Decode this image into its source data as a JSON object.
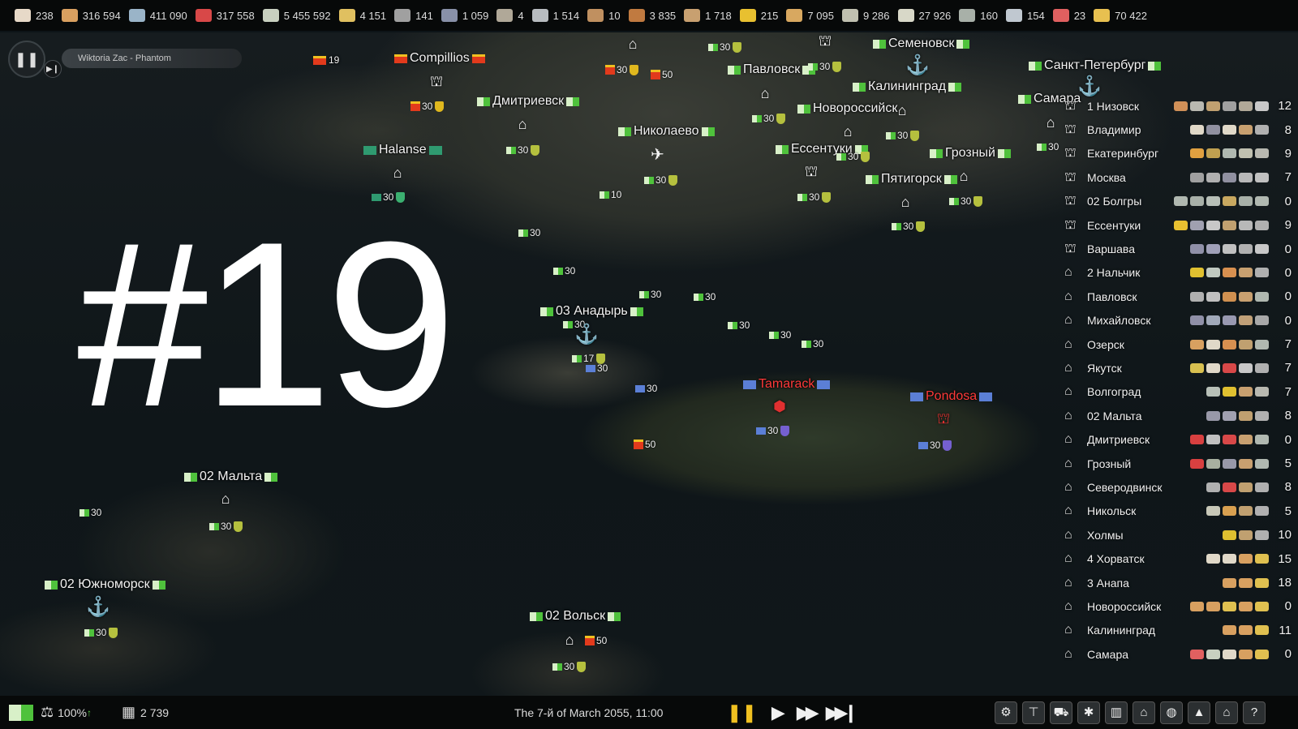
{
  "resources": [
    {
      "value": "238",
      "icon": "paper-icon",
      "color": "#e7d9c8"
    },
    {
      "value": "316 594",
      "icon": "bread-icon",
      "color": "#d9a060"
    },
    {
      "value": "411 090",
      "icon": "feather-icon",
      "color": "#9ab4c8"
    },
    {
      "value": "317 558",
      "icon": "meat-can-icon",
      "color": "#d84848"
    },
    {
      "value": "5 455 592",
      "icon": "bandage-icon",
      "color": "#c8d0c0"
    },
    {
      "value": "4 151",
      "icon": "bullets-icon",
      "color": "#e0c060"
    },
    {
      "value": "141",
      "icon": "ore-icon",
      "color": "#a0a0a0"
    },
    {
      "value": "1 059",
      "icon": "steel-bar-icon",
      "color": "#8890a8"
    },
    {
      "value": "4",
      "icon": "ore-pile-icon",
      "color": "#b0a898"
    },
    {
      "value": "1 514",
      "icon": "metal-bar-icon",
      "color": "#b8bcc0"
    },
    {
      "value": "10",
      "icon": "nuts-icon",
      "color": "#c09060"
    },
    {
      "value": "3 835",
      "icon": "wood-log-icon",
      "color": "#c07a40"
    },
    {
      "value": "1 718",
      "icon": "grain-pile-icon",
      "color": "#c8a070"
    },
    {
      "value": "215",
      "icon": "gold-bar-icon",
      "color": "#e8c030"
    },
    {
      "value": "7 095",
      "icon": "baguette-icon",
      "color": "#d8a860"
    },
    {
      "value": "9 286",
      "icon": "crate-icon",
      "color": "#c0c0b0"
    },
    {
      "value": "27 926",
      "icon": "cotton-icon",
      "color": "#d8d8c8"
    },
    {
      "value": "160",
      "icon": "board-icon",
      "color": "#a8b0a8"
    },
    {
      "value": "154",
      "icon": "bottle-icon",
      "color": "#c0c8d0"
    },
    {
      "value": "23",
      "icon": "ham-icon",
      "color": "#e06060"
    },
    {
      "value": "70 422",
      "icon": "corn-icon",
      "color": "#e8c050"
    }
  ],
  "player": {
    "pause_glyph": "❚❚",
    "skip_glyph": "▶❙",
    "track": "Wiktoria Zac - Phantom"
  },
  "overlay_number": "#19",
  "map_labels": {
    "compillios": "Compillios",
    "dmitrievsk": "Дмитриевск",
    "halanse": "Halanse",
    "pavlovsk": "Павловск",
    "semenovsk": "Семеновск",
    "spb": "Санкт-Петербург",
    "kaliningrad": "Калининград",
    "novorossiysk": "Новороссийск",
    "samara": "Самара",
    "nikolaevo": "Николаево",
    "yessentuki": "Ессентуки",
    "grozny": "Грозный",
    "pyatigorsk": "Пятигорск",
    "anadyr": "03 Анадырь",
    "tamarack": "Tamarack",
    "pondosa": "Pondosa",
    "malta": "02 Мальта",
    "yuzhnomorsk": "02 Южноморск",
    "volsk": "02 Вольск"
  },
  "map_numbers": {
    "n19": "19",
    "n30": "30",
    "n50": "50",
    "n10": "10",
    "n17": "17"
  },
  "settlements": [
    {
      "icon": "factory-icon",
      "name": "1 Низовск",
      "items": [
        "#d09058",
        "#b8b8b0",
        "#c0a070",
        "#a0a0a0",
        "#b0a898",
        "#c8c8c8"
      ],
      "count": "12"
    },
    {
      "icon": "factory-icon",
      "name": "Владимир",
      "items": [
        "#e0d8c8",
        "#9090a0",
        "#e0d8c8",
        "#c8a070",
        "#b0b0b0"
      ],
      "count": "8"
    },
    {
      "icon": "factory-icon",
      "name": "Екатеринбург",
      "items": [
        "#e0a040",
        "#c0a050",
        "#b0b8b0",
        "#c0c0b0",
        "#b8b8b0"
      ],
      "count": "9"
    },
    {
      "icon": "factory-icon",
      "name": "Москва",
      "items": [
        "#a0a0a0",
        "#b0b0b0",
        "#9090a0",
        "#b8b8b8",
        "#c0c0c0"
      ],
      "count": "7"
    },
    {
      "icon": "factory-icon",
      "name": "02 Болгры",
      "items": [
        "#b0b8b0",
        "#a8b0a8",
        "#b8c0b8",
        "#c8a860",
        "#a8b0a8",
        "#b0b8b0"
      ],
      "count": "0"
    },
    {
      "icon": "factory-icon",
      "name": "Ессентуки",
      "items": [
        "#e8c030",
        "#a0a0b0",
        "#c8c8c8",
        "#c0a070",
        "#b8b8b8",
        "#b0b0b0"
      ],
      "count": "9"
    },
    {
      "icon": "factory-icon",
      "name": "Варшава",
      "items": [
        "#9090a8",
        "#a0a0b8",
        "#c0c0c0",
        "#b0b0b0",
        "#c8c8c8"
      ],
      "count": "0"
    },
    {
      "icon": "warehouse-icon",
      "name": "2 Нальчик",
      "items": [
        "#e0c030",
        "#c0c8c0",
        "#d89050",
        "#c8a070",
        "#b0b0b0"
      ],
      "count": "0"
    },
    {
      "icon": "warehouse-icon",
      "name": "Павловск",
      "items": [
        "#b0b0b0",
        "#c0c0c0",
        "#d09050",
        "#c8a070",
        "#b0b8b0"
      ],
      "count": "0"
    },
    {
      "icon": "warehouse-icon",
      "name": "Михайловск",
      "items": [
        "#9090a8",
        "#a0a8b8",
        "#9898b0",
        "#c0a078",
        "#a8a8a8"
      ],
      "count": "0"
    },
    {
      "icon": "warehouse-icon",
      "name": "Озерск",
      "items": [
        "#d8a060",
        "#e0d8c8",
        "#d89050",
        "#c0a070",
        "#b0b8b0"
      ],
      "count": "7"
    },
    {
      "icon": "warehouse-icon",
      "name": "Якутск",
      "items": [
        "#d8c050",
        "#e0d8c8",
        "#d84848",
        "#c8c8c8",
        "#b0b0b0"
      ],
      "count": "7"
    },
    {
      "icon": "warehouse-icon",
      "name": "Волгоград",
      "items": [
        "#b8c0b8",
        "#e0c030",
        "#c8a070",
        "#b8b8b0"
      ],
      "count": "7"
    },
    {
      "icon": "warehouse-icon",
      "name": "02 Мальта",
      "items": [
        "#9898a8",
        "#a0a0b0",
        "#c0a070",
        "#b0b0b0"
      ],
      "count": "8"
    },
    {
      "icon": "warehouse-icon",
      "name": "Дмитриевск",
      "items": [
        "#d84040",
        "#c0c0c0",
        "#d84848",
        "#c8a070",
        "#b0b8b0"
      ],
      "count": "0"
    },
    {
      "icon": "warehouse-icon",
      "name": "Грозный",
      "items": [
        "#d84040",
        "#a8b0a0",
        "#9898a8",
        "#c8a070",
        "#b0b8b0"
      ],
      "count": "5"
    },
    {
      "icon": "warehouse-icon",
      "name": "Северодвинск",
      "items": [
        "#b0b0b0",
        "#d84848",
        "#c0a070",
        "#b0b0b0"
      ],
      "count": "8"
    },
    {
      "icon": "warehouse-icon",
      "name": "Никольск",
      "items": [
        "#c8c8b8",
        "#d8a050",
        "#c0a070",
        "#b0b0b0"
      ],
      "count": "5"
    },
    {
      "icon": "warehouse-icon",
      "name": "Холмы",
      "items": [
        "#e0c030",
        "#c0a070",
        "#b0b0b0"
      ],
      "count": "10"
    },
    {
      "icon": "farm-icon",
      "name": "4 Хорватск",
      "items": [
        "#e0d8c8",
        "#e0d8c8",
        "#d8a060",
        "#e0c050"
      ],
      "count": "15"
    },
    {
      "icon": "farm-icon",
      "name": "3 Анапа",
      "items": [
        "#d8a060",
        "#d8a060",
        "#e0c050"
      ],
      "count": "18"
    },
    {
      "icon": "farm-icon",
      "name": "Новороссийск",
      "items": [
        "#d8a060",
        "#d8a060",
        "#e0c050",
        "#d8a060",
        "#e0c050"
      ],
      "count": "0"
    },
    {
      "icon": "farm-icon",
      "name": "Калининград",
      "items": [
        "#d8a060",
        "#d8a060",
        "#e0c050"
      ],
      "count": "11"
    },
    {
      "icon": "farm-icon",
      "name": "Самара",
      "items": [
        "#e06060",
        "#c8d0c0",
        "#e0d8c8",
        "#d8a060",
        "#e0c050"
      ],
      "count": "0"
    }
  ],
  "bottom": {
    "approval": "100%",
    "approval_arrow": "↑",
    "population": "2 739",
    "date": "The 7-й of March 2055, 11:00",
    "controls": [
      "❚❚",
      "▶",
      "▶▶",
      "▶▶❙"
    ],
    "tools": [
      "gear-icon",
      "crane-icon",
      "road-icon",
      "bug-icon",
      "building-icon",
      "factory-icon",
      "globe-icon",
      "chart-icon",
      "bank-icon",
      "help-icon"
    ],
    "tool_glyphs": [
      "⚙",
      "⊤",
      "⛟",
      "✱",
      "▥",
      "⌂",
      "◍",
      "▲",
      "⌂",
      "?"
    ]
  }
}
